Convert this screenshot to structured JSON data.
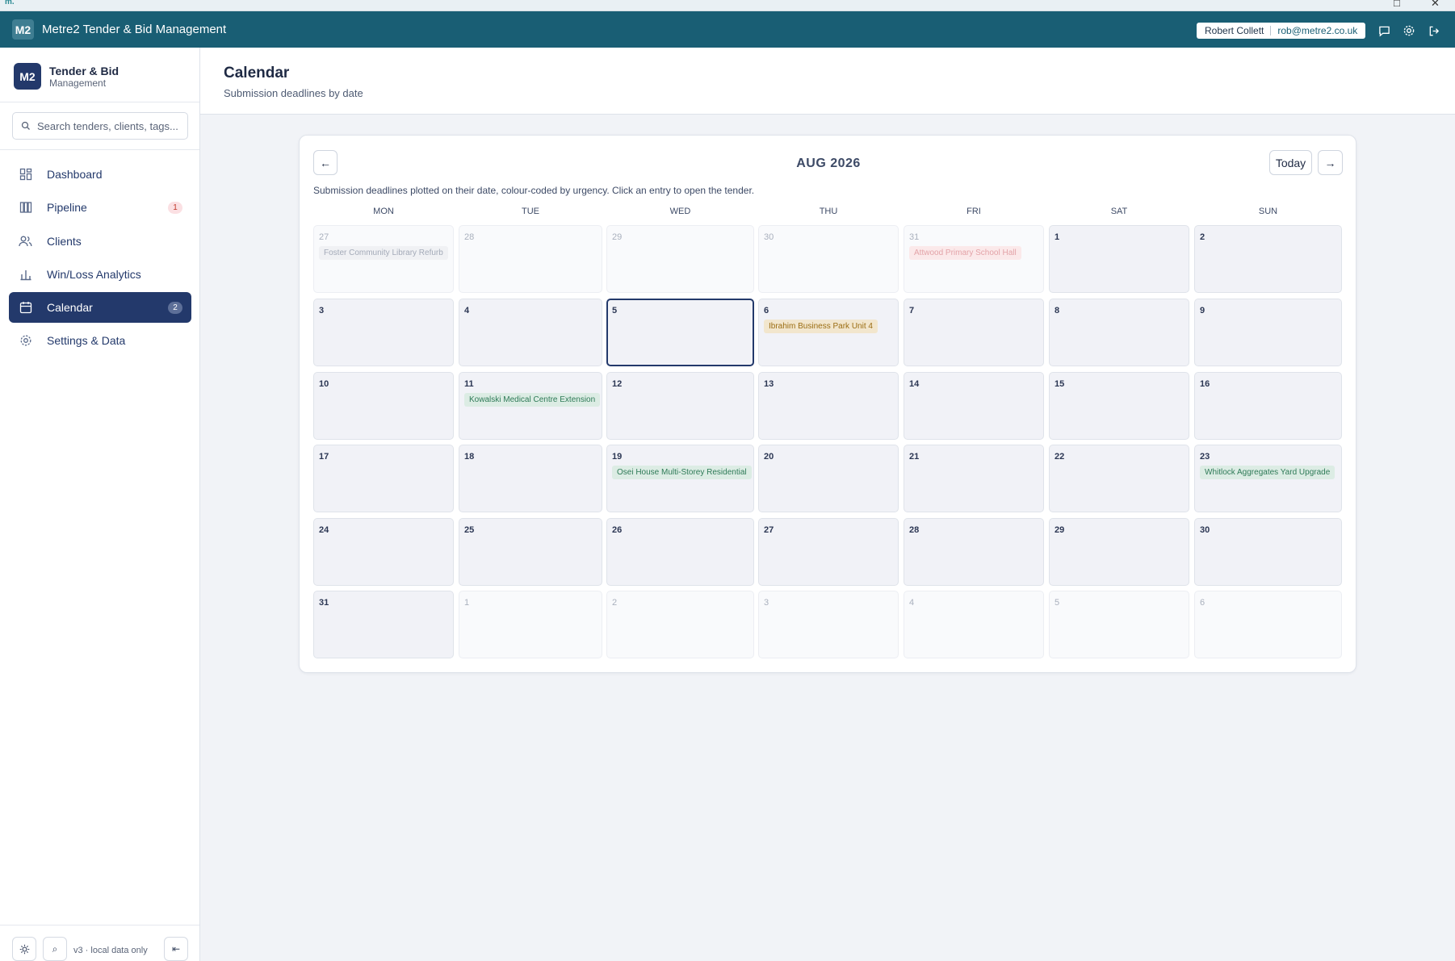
{
  "os": {
    "logo": "m.",
    "maximize": "□",
    "close": "✕"
  },
  "header": {
    "badge": "M2",
    "title": "Metre2 Tender & Bid Management",
    "user_name": "Robert Collett",
    "user_email": "rob@metre2.co.uk"
  },
  "sidebar": {
    "brand_badge": "M2",
    "brand_title": "Tender & Bid",
    "brand_sub": "Management",
    "search_placeholder": "Search tenders, clients, tags...",
    "items": [
      {
        "label": "Dashboard",
        "icon": "dashboard-icon",
        "badge": null,
        "active": false
      },
      {
        "label": "Pipeline",
        "icon": "pipeline-icon",
        "badge": "1",
        "active": false
      },
      {
        "label": "Clients",
        "icon": "users-icon",
        "badge": null,
        "active": false
      },
      {
        "label": "Win/Loss Analytics",
        "icon": "bar-chart-icon",
        "badge": null,
        "active": false
      },
      {
        "label": "Calendar",
        "icon": "calendar-icon",
        "badge": "2",
        "active": true
      },
      {
        "label": "Settings & Data",
        "icon": "gear-icon",
        "badge": null,
        "active": false
      }
    ],
    "footer_text": "v3 · local data only",
    "footer_btn_search": "⌕",
    "footer_btn_collapse": "⇤"
  },
  "page": {
    "title": "Calendar",
    "subtitle": "Submission deadlines by date"
  },
  "calendar": {
    "month_label": "AUG 2026",
    "prev": "←",
    "next": "→",
    "today": "Today",
    "hint": "Submission deadlines plotted on their date, colour-coded by urgency. Click an entry to open the tender.",
    "weekdays": [
      "MON",
      "TUE",
      "WED",
      "THU",
      "FRI",
      "SAT",
      "SUN"
    ],
    "cells": [
      {
        "day": "27",
        "other": true,
        "entry": "Foster Community Library Refurb",
        "entry_style": "faded-grey"
      },
      {
        "day": "28",
        "other": true
      },
      {
        "day": "29",
        "other": true
      },
      {
        "day": "30",
        "other": true
      },
      {
        "day": "31",
        "other": true,
        "entry": "Attwood Primary School Hall",
        "entry_style": "faded-red"
      },
      {
        "day": "1"
      },
      {
        "day": "2"
      },
      {
        "day": "3"
      },
      {
        "day": "4"
      },
      {
        "day": "5",
        "today": true
      },
      {
        "day": "6",
        "entry": "Ibrahim Business Park Unit 4",
        "entry_style": "amber"
      },
      {
        "day": "7"
      },
      {
        "day": "8"
      },
      {
        "day": "9"
      },
      {
        "day": "10"
      },
      {
        "day": "11",
        "entry": "Kowalski Medical Centre Extension",
        "entry_style": "green"
      },
      {
        "day": "12"
      },
      {
        "day": "13"
      },
      {
        "day": "14"
      },
      {
        "day": "15"
      },
      {
        "day": "16"
      },
      {
        "day": "17"
      },
      {
        "day": "18"
      },
      {
        "day": "19",
        "entry": "Osei House Multi-Storey Residential",
        "entry_style": "green"
      },
      {
        "day": "20"
      },
      {
        "day": "21"
      },
      {
        "day": "22"
      },
      {
        "day": "23",
        "entry": "Whitlock Aggregates Yard Upgrade",
        "entry_style": "green"
      },
      {
        "day": "24"
      },
      {
        "day": "25"
      },
      {
        "day": "26"
      },
      {
        "day": "27"
      },
      {
        "day": "28"
      },
      {
        "day": "29"
      },
      {
        "day": "30"
      },
      {
        "day": "31"
      },
      {
        "day": "1",
        "other": true
      },
      {
        "day": "2",
        "other": true
      },
      {
        "day": "3",
        "other": true
      },
      {
        "day": "4",
        "other": true
      },
      {
        "day": "5",
        "other": true
      },
      {
        "day": "6",
        "other": true
      }
    ]
  }
}
